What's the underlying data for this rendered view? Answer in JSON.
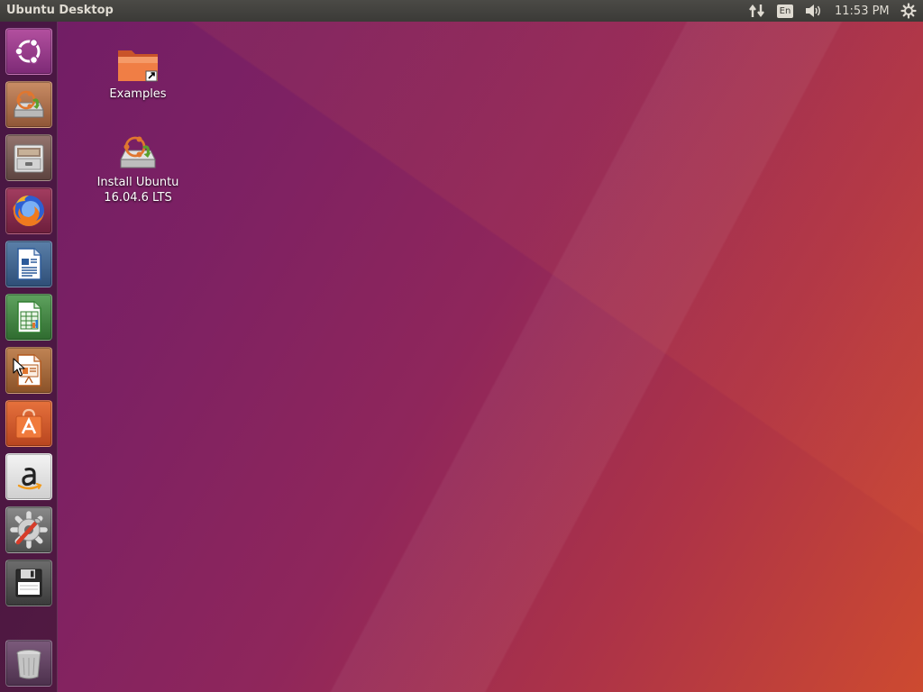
{
  "top_panel": {
    "title": "Ubuntu Desktop",
    "keyboard_layout": "En",
    "clock": "11:53 PM",
    "indicators": [
      "network-icon",
      "keyboard-layout-indicator",
      "sound-icon",
      "session-gear-icon"
    ]
  },
  "launcher": {
    "items": [
      {
        "icon": "dash-ubuntu-icon",
        "color": "#8e3d8c"
      },
      {
        "icon": "install-ubuntu-icon",
        "color": "#b06a4a"
      },
      {
        "icon": "files-icon",
        "color": "#7a5b56"
      },
      {
        "icon": "firefox-icon",
        "color": "#8a2a4a"
      },
      {
        "icon": "libreoffice-writer-icon",
        "color": "#3d5f86"
      },
      {
        "icon": "libreoffice-calc-icon",
        "color": "#3d7a3d"
      },
      {
        "icon": "libreoffice-impress-icon",
        "color": "#a0643a"
      },
      {
        "icon": "ubuntu-software-icon",
        "color": "#d4582c"
      },
      {
        "icon": "amazon-icon",
        "color": "#e8e8e8"
      },
      {
        "icon": "system-settings-icon",
        "color": "#6e6e6e"
      },
      {
        "icon": "floppy-disk-icon",
        "color": "#555555"
      },
      {
        "icon": "trash-icon",
        "color": "#6b4a6b"
      }
    ]
  },
  "desktop": {
    "icons": [
      {
        "label": "Examples",
        "icon": "folder-link-icon"
      },
      {
        "label_line1": "Install Ubuntu",
        "label_line2": "16.04.6 LTS",
        "icon": "install-ubuntu-icon"
      }
    ]
  },
  "colors": {
    "panel": "#3c3b37",
    "panel_text": "#dfdbd2",
    "wallpaper_start": "#6f1d66",
    "wallpaper_end": "#cd4a30"
  }
}
